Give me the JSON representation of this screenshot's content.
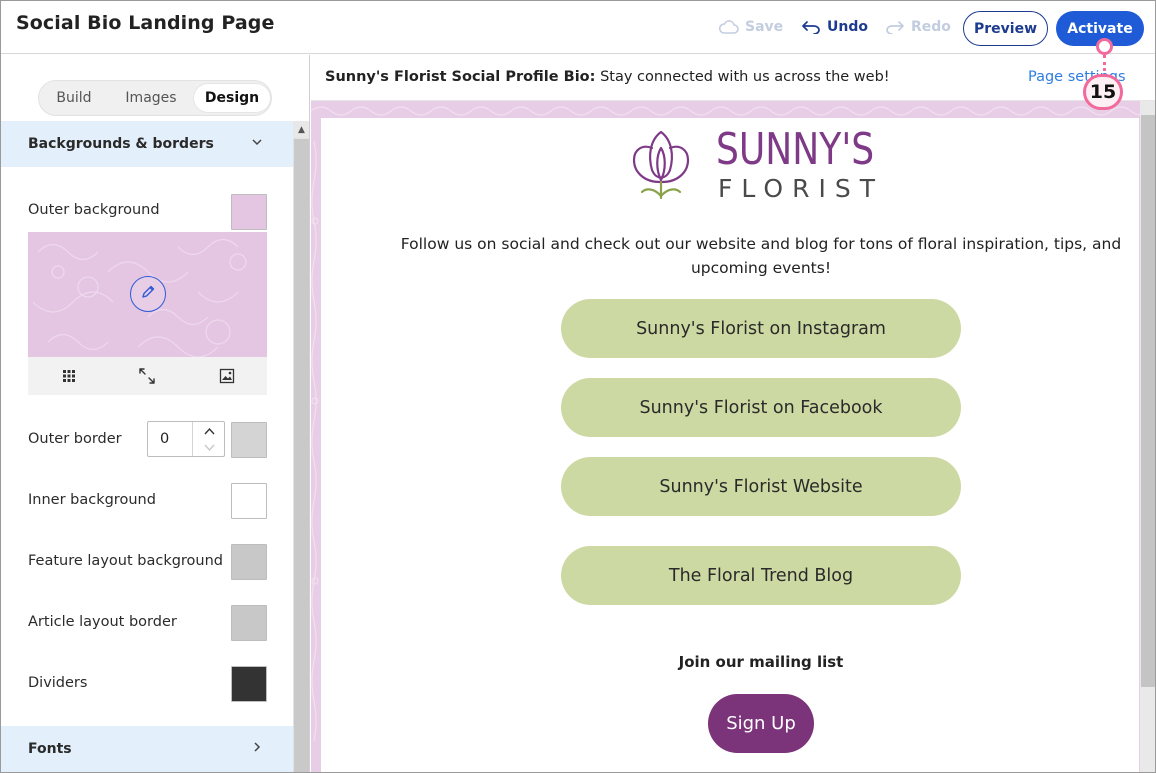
{
  "app": {
    "title": "Social Bio Landing Page",
    "save_label": "Save",
    "undo_label": "Undo",
    "redo_label": "Redo",
    "preview_label": "Preview",
    "activate_label": "Activate",
    "callout_number": "15"
  },
  "sidebar": {
    "tabs": [
      {
        "label": "Build",
        "active": false
      },
      {
        "label": "Images",
        "active": false
      },
      {
        "label": "Design",
        "active": true
      }
    ],
    "section_backgrounds": "Backgrounds & borders",
    "section_fonts": "Fonts",
    "outer_background": {
      "label": "Outer background",
      "color": "#e4c5e2"
    },
    "outer_border": {
      "label": "Outer border",
      "value": "0",
      "color": "#d4d4d4"
    },
    "inner_background": {
      "label": "Inner background",
      "color": "#ffffff"
    },
    "feature_layout_background": {
      "label": "Feature layout background",
      "color": "#c8c8c8"
    },
    "article_layout_border": {
      "label": "Article layout border",
      "color": "#c8c8c8"
    },
    "dividers": {
      "label": "Dividers",
      "color": "#333333"
    },
    "image_tools": [
      "grid-icon",
      "expand-icon",
      "image-fit-icon"
    ]
  },
  "preview": {
    "info_title_bold": "Sunny's Florist Social Profile Bio:",
    "info_title_rest": "Stay connected with us across the web!",
    "page_settings": "Page settings",
    "logo_line1": "SUNNY'S",
    "logo_line2": "FLORIST",
    "intro": "Follow us on social and check out our website and blog for tons of floral inspiration, tips, and upcoming events!",
    "links": [
      "Sunny's Florist on Instagram",
      "Sunny's Florist on Facebook",
      "Sunny's Florist Website",
      "The Floral Trend Blog"
    ],
    "mailing_label": "Join our mailing list",
    "signup_label": "Sign Up",
    "colors": {
      "outer_bg": "#e8cde6",
      "link_button": "#cdd9a3",
      "signup_button": "#7b3479",
      "logo_purple": "#7e3a86",
      "accent_blue": "#1f5bd6"
    }
  }
}
